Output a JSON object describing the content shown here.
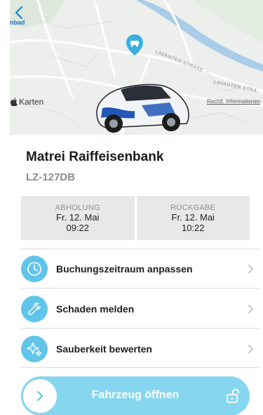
{
  "map": {
    "town_label": "nbad",
    "brand_label": "Karten",
    "legal_link": "Rechtl. Informationen",
    "street_label_1": "LAVANTER STRAßE",
    "street_label_2": "LAVANTER STRA"
  },
  "station": {
    "name": "Matrei Raiffeisenbank",
    "plate": "LZ-127DB"
  },
  "booking": {
    "pickup_label": "ABHOLUNG",
    "pickup_date": "Fr. 12. Mai",
    "pickup_time": "09:22",
    "return_label": "RÜCKGABE",
    "return_date": "Fr. 12. Mai",
    "return_time": "10:22"
  },
  "actions": [
    {
      "label": "Buchungszeitraum anpassen",
      "icon": "clock-icon"
    },
    {
      "label": "Schaden melden",
      "icon": "wrench-icon"
    },
    {
      "label": "Sauberkeit bewerten",
      "icon": "sparkle-icon"
    }
  ],
  "open_button": {
    "label": "Fahrzeug öffnen"
  },
  "colors": {
    "accent": "#60c5e8",
    "open_button": "#86d6f0",
    "back_arrow": "#2b8fd6"
  }
}
